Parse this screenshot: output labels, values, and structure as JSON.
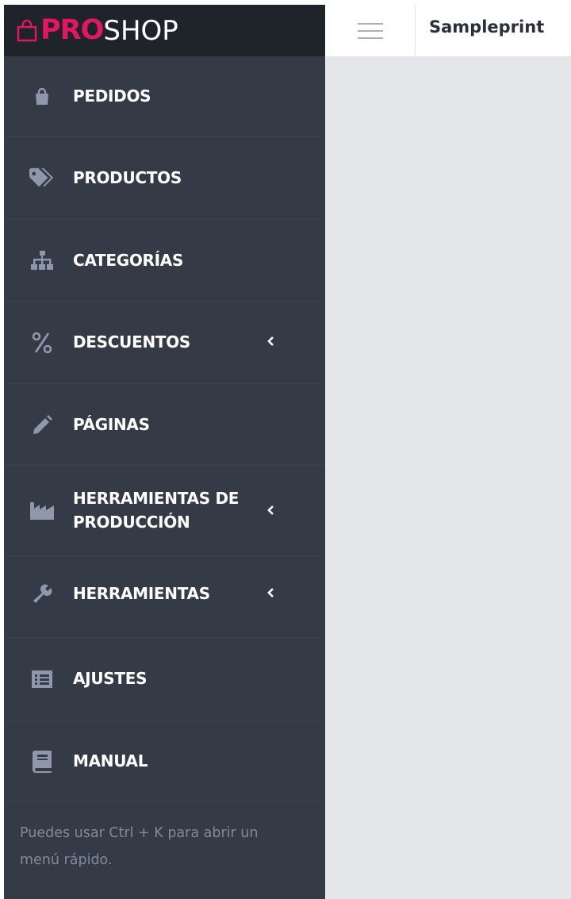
{
  "brand": {
    "logo_pro": "PRO",
    "logo_shop": "SHOP",
    "accent": "#e3175e"
  },
  "topbar": {
    "shop_name": "Sampleprint",
    "menu_icon": "hamburger-icon"
  },
  "sidebar": {
    "items": [
      {
        "label": "PEDIDOS",
        "icon": "shopping-bag-icon",
        "has_submenu": false
      },
      {
        "label": "PRODUCTOS",
        "icon": "tags-icon",
        "has_submenu": false
      },
      {
        "label": "CATEGORÍAS",
        "icon": "sitemap-icon",
        "has_submenu": false
      },
      {
        "label": "DESCUENTOS",
        "icon": "percent-icon",
        "has_submenu": true
      },
      {
        "label": "PÁGINAS",
        "icon": "pencil-icon",
        "has_submenu": false
      },
      {
        "label_line1": "HERRAMIENTAS DE",
        "label_line2": "PRODUCCIÓN",
        "icon": "industry-icon",
        "has_submenu": true
      },
      {
        "label": "HERRAMIENTAS",
        "icon": "wrench-icon",
        "has_submenu": true
      },
      {
        "label": "AJUSTES",
        "icon": "list-icon",
        "has_submenu": false
      },
      {
        "label": "MANUAL",
        "icon": "book-icon",
        "has_submenu": false
      }
    ],
    "hint_line1": "Puedes usar Ctrl + K para abrir un",
    "hint_line2": "menú rápido."
  }
}
